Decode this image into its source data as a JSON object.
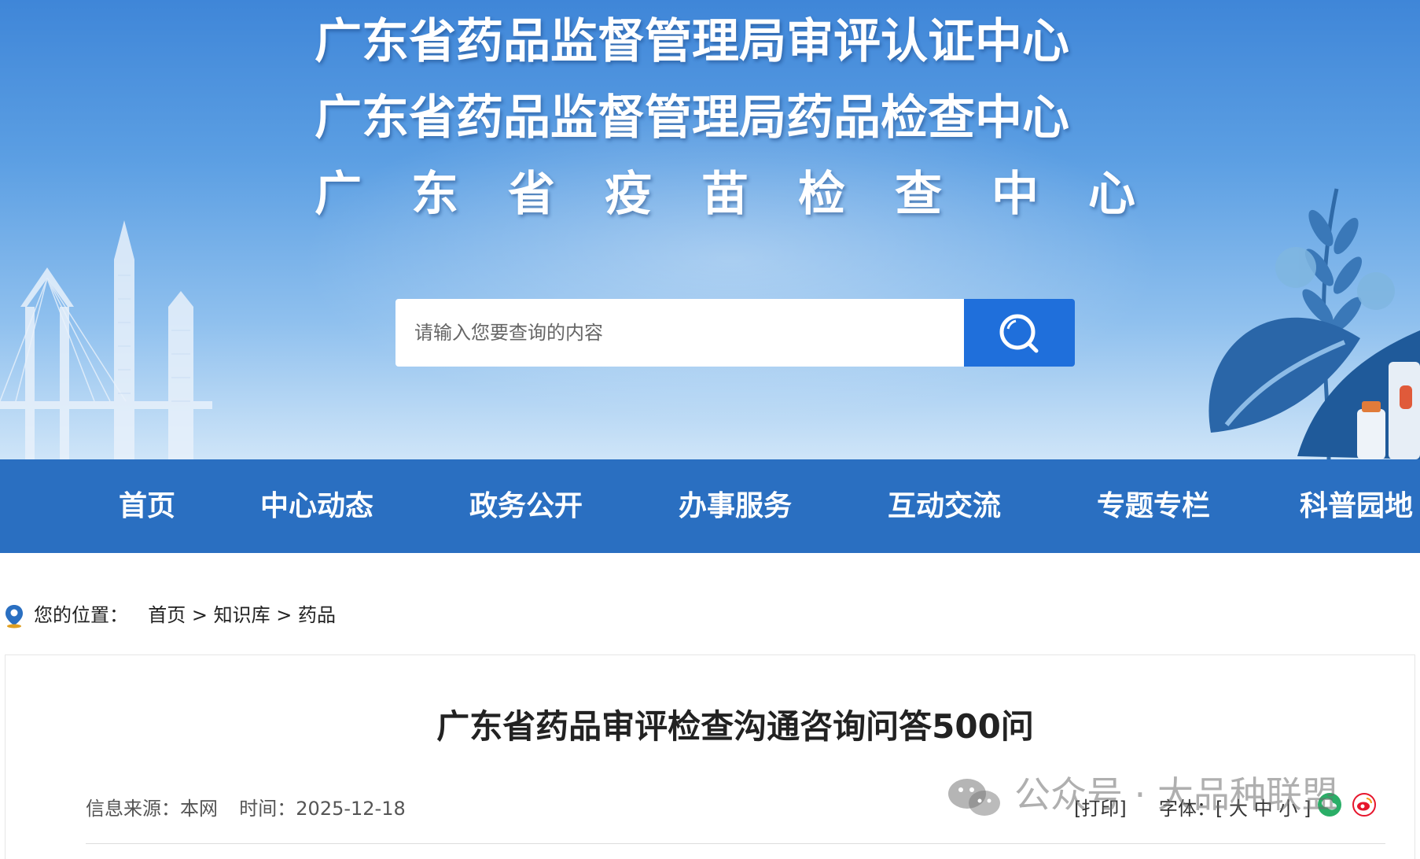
{
  "banner": {
    "title_lines": [
      "广东省药品监督管理局审评认证中心",
      "广东省药品监督管理局药品检查中心",
      "广东省疫苗检查中心"
    ],
    "search_placeholder": "请输入您要查询的内容"
  },
  "nav": {
    "items": [
      "首页",
      "中心动态",
      "政务公开",
      "办事服务",
      "互动交流",
      "专题专栏",
      "科普园地"
    ]
  },
  "breadcrumb": {
    "prefix": "您的位置：",
    "items": [
      "首页",
      "知识库",
      "药品"
    ],
    "separator": " > "
  },
  "article": {
    "title": "广东省药品审评检查沟通咨询问答500问",
    "source_label": "信息来源：",
    "source_value": "本网",
    "time_label": "时间：",
    "time_value": "2025-12-18"
  },
  "tools": {
    "print": "[打印]",
    "font_label": "字体：[",
    "font_large": "大",
    "font_medium": "中",
    "font_small": "小",
    "font_close": "]"
  },
  "watermark": {
    "text": "公众号 · 大品种联盟"
  },
  "colors": {
    "nav_bg": "#2a6fc1",
    "search_button": "#1f6fdb",
    "banner_top": "#3f86d8",
    "wechat_green": "#2aae67",
    "weibo_red": "#e6162d"
  }
}
